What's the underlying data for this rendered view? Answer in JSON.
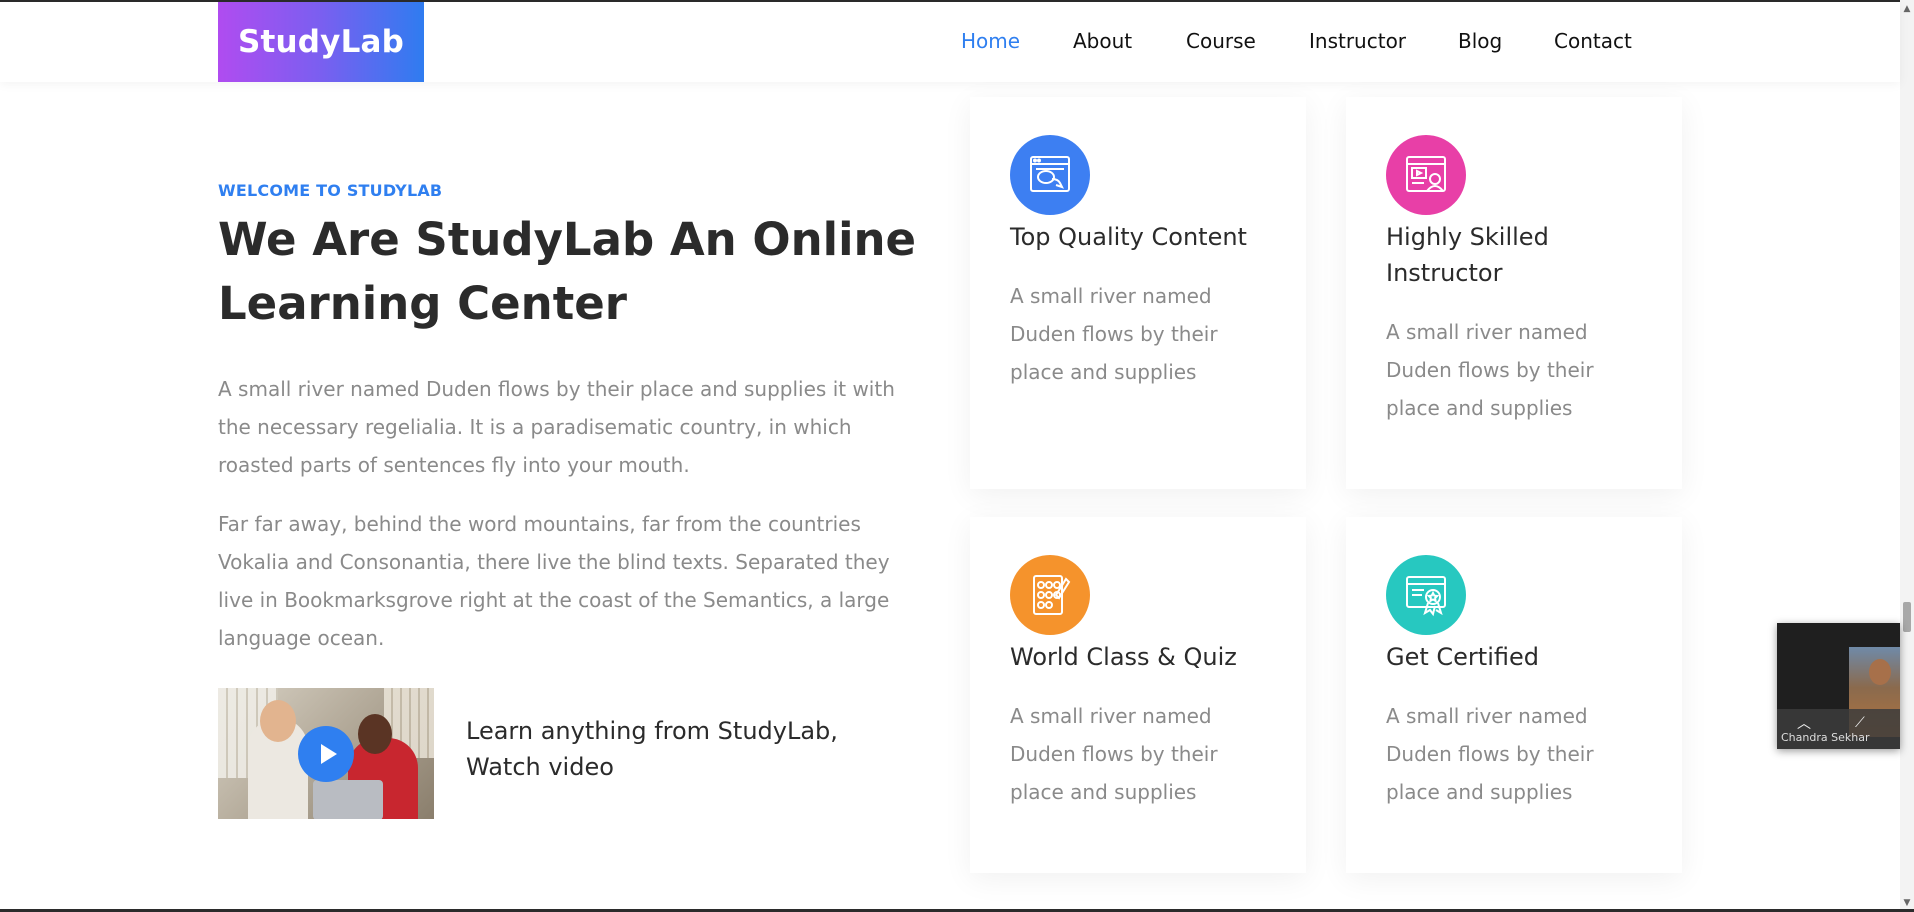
{
  "logo": {
    "text": "StudyLab"
  },
  "nav": {
    "items": [
      {
        "label": "Home",
        "active": true
      },
      {
        "label": "About",
        "active": false
      },
      {
        "label": "Course",
        "active": false
      },
      {
        "label": "Instructor",
        "active": false
      },
      {
        "label": "Blog",
        "active": false
      },
      {
        "label": "Contact",
        "active": false
      }
    ]
  },
  "hero": {
    "eyebrow": "WELCOME TO STUDYLAB",
    "headline": "We Are StudyLab An Online Learning Center",
    "paragraph1": "A small river named Duden flows by their place and supplies it with the necessary regelialia. It is a paradisematic country, in which roasted parts of sentences fly into your mouth.",
    "paragraph2": "Far far away, behind the word mountains, far from the countries Vokalia and Consonantia, there live the blind texts. Separated they live in Bookmarksgrove right at the coast of the Semantics, a large language ocean.",
    "video_text": "Learn anything from StudyLab, Watch video"
  },
  "features": [
    {
      "icon": "web-chat-icon",
      "color": "#3d7ff2",
      "title": "Top Quality Content",
      "text": "A small river named Duden flows by their place and supplies"
    },
    {
      "icon": "video-instructor-icon",
      "color": "#e83fa7",
      "title": "Highly Skilled Instructor",
      "text": "A small river named Duden flows by their place and supplies"
    },
    {
      "icon": "quiz-sheet-icon",
      "color": "#f5932c",
      "title": "World Class & Quiz",
      "text": "A small river named Duden flows by their place and supplies"
    },
    {
      "icon": "certificate-icon",
      "color": "#27c8c0",
      "title": "Get Certified",
      "text": "A small river named Duden flows by their place and supplies"
    }
  ],
  "video_call": {
    "name": "Chandra Sekhar"
  },
  "colors": {
    "accent": "#2f7ff0",
    "heading": "#2b2b2b",
    "body_text": "#8a8a8a"
  }
}
